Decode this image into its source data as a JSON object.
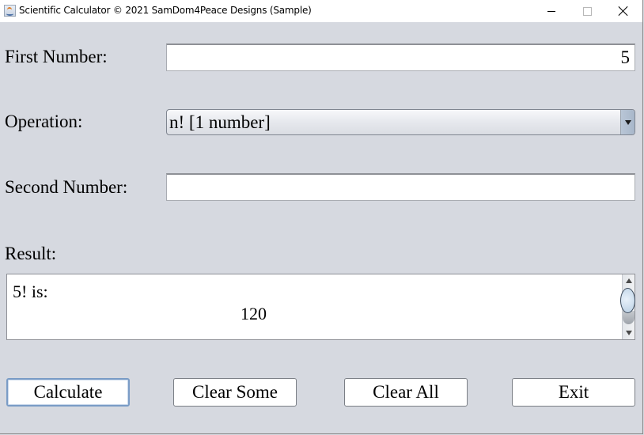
{
  "window": {
    "title": "Scientific Calculator © 2021 SamDom4Peace Designs (Sample)",
    "app_icon": "java-icon",
    "controls": {
      "minimize": "minimize-icon",
      "maximize": "maximize-icon",
      "close": "close-icon"
    }
  },
  "form": {
    "first_number": {
      "label": "First Number:",
      "value": "5"
    },
    "operation": {
      "label": "Operation:",
      "selected": "n! [1 number]"
    },
    "second_number": {
      "label": "Second Number:",
      "value": ""
    },
    "result": {
      "label": "Result:",
      "lines": [
        "5! is:",
        "120"
      ]
    }
  },
  "buttons": {
    "calculate": "Calculate",
    "clear_some": "Clear Some",
    "clear_all": "Clear All",
    "exit": "Exit"
  }
}
